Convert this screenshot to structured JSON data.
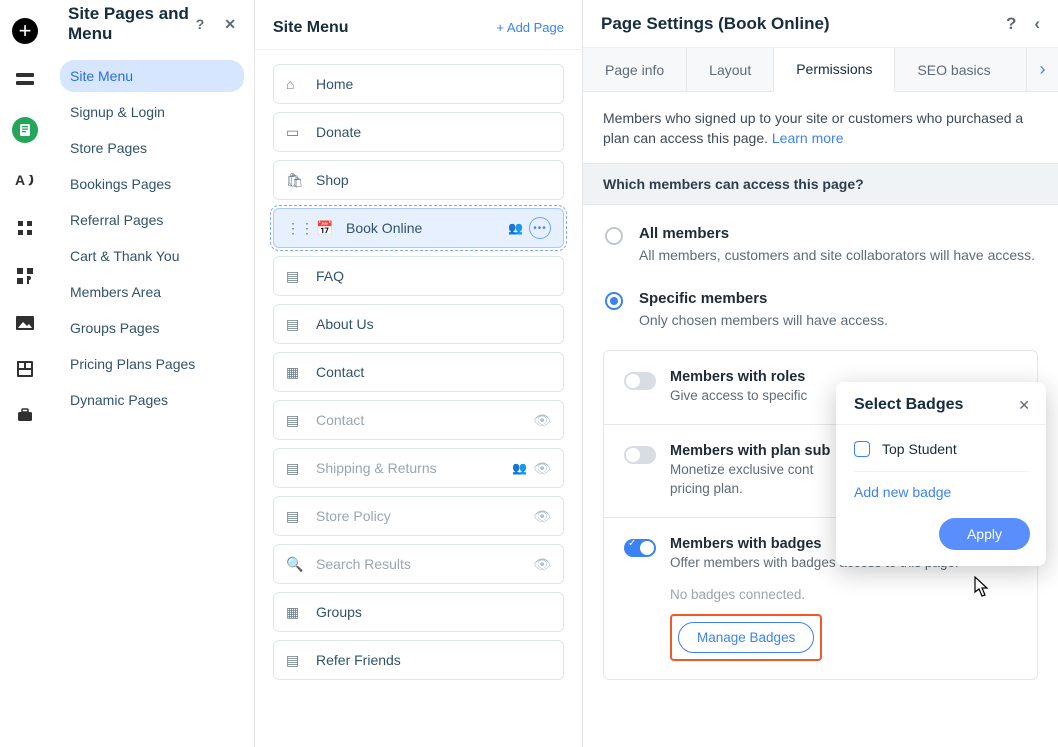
{
  "header1": {
    "title": "Site Pages and Menu",
    "help": "?",
    "close": "✕"
  },
  "sidebar": {
    "items": [
      {
        "label": "Site Menu"
      },
      {
        "label": "Signup & Login"
      },
      {
        "label": "Store Pages"
      },
      {
        "label": "Bookings Pages"
      },
      {
        "label": "Referral Pages"
      },
      {
        "label": "Cart & Thank You"
      },
      {
        "label": "Members Area"
      },
      {
        "label": "Groups Pages"
      },
      {
        "label": "Pricing Plans Pages"
      },
      {
        "label": "Dynamic Pages"
      }
    ]
  },
  "menu": {
    "title": "Site Menu",
    "add": "+  Add Page",
    "items": [
      {
        "label": "Home"
      },
      {
        "label": "Donate"
      },
      {
        "label": "Shop"
      },
      {
        "label": "Book Online"
      },
      {
        "label": "FAQ"
      },
      {
        "label": "About Us"
      },
      {
        "label": "Contact"
      },
      {
        "label": "Contact"
      },
      {
        "label": "Shipping & Returns"
      },
      {
        "label": "Store Policy"
      },
      {
        "label": "Search Results"
      },
      {
        "label": "Groups"
      },
      {
        "label": "Refer Friends"
      }
    ]
  },
  "settings": {
    "title": "Page Settings (Book Online)",
    "help": "?",
    "back": "‹",
    "tabs": {
      "info": "Page info",
      "layout": "Layout",
      "perm": "Permissions",
      "seo": "SEO basics",
      "next": "›"
    },
    "descr": "Members who signed up to your site or customers who purchased a plan can access this page. ",
    "learn": "Learn more",
    "section": "Which members can access this page?",
    "opt1": {
      "t": "All members",
      "s": "All members, customers and site collaborators will have access."
    },
    "opt2": {
      "t": "Specific members",
      "s": "Only chosen members will have access."
    },
    "c1": {
      "t": "Members with roles",
      "s": "Give access to specific "
    },
    "c2": {
      "t": "Members with plan sub",
      "s": "Monetize exclusive cont",
      "s2": "pricing plan."
    },
    "c3": {
      "t": "Members with badges",
      "s": "Offer members with badges access to this page.",
      "note": "No badges connected.",
      "btn": "Manage Badges"
    }
  },
  "popover": {
    "title": "Select Badges",
    "close": "✕",
    "item": "Top Student",
    "add": "Add new badge",
    "apply": "Apply"
  }
}
